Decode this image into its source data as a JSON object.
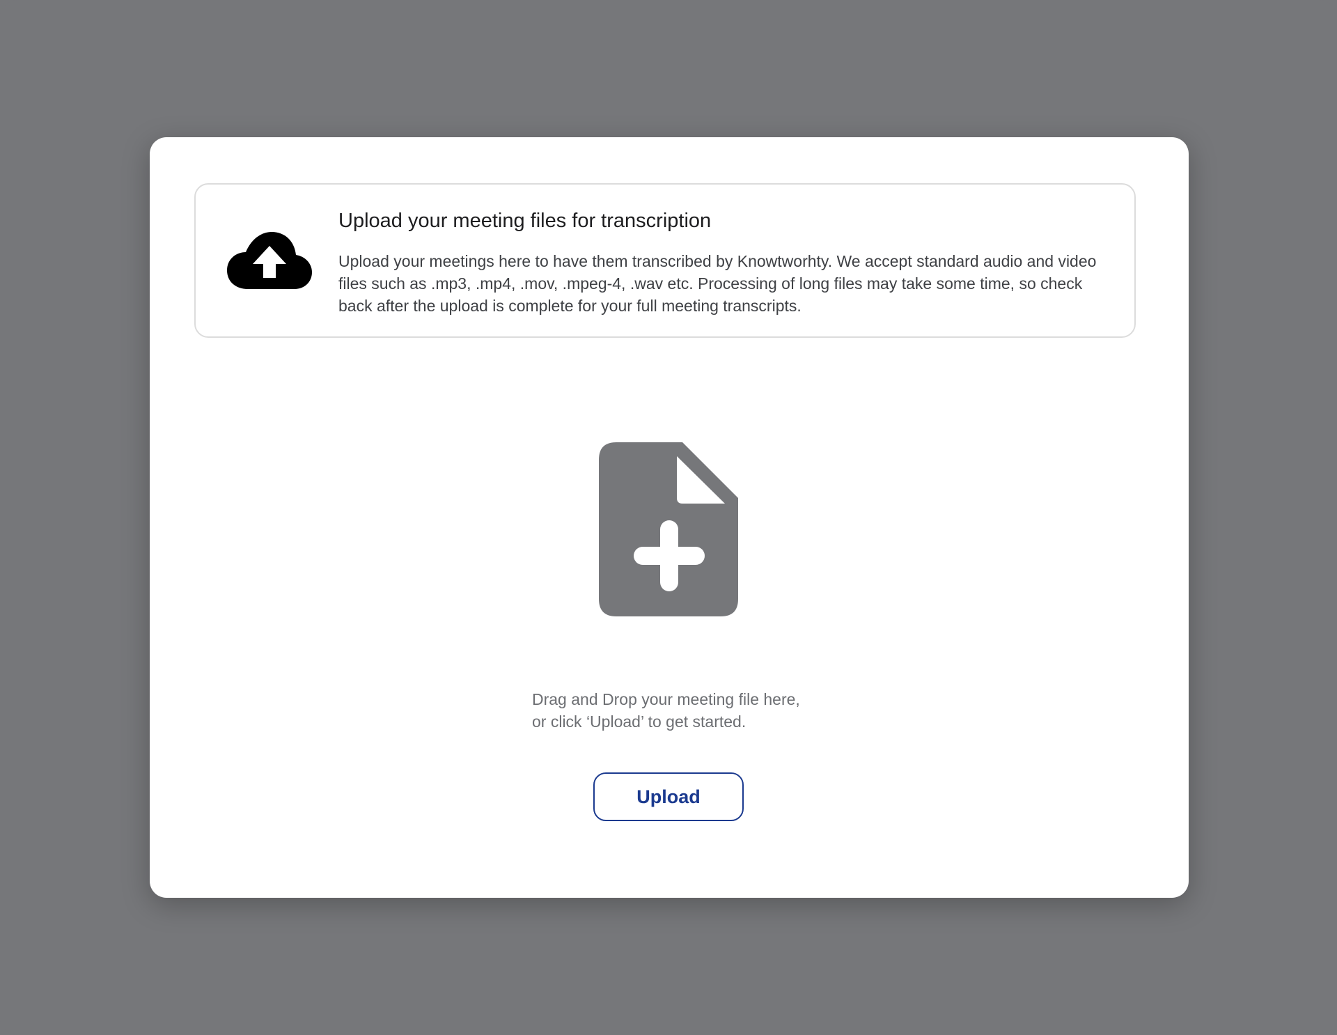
{
  "info": {
    "title": "Upload your meeting files for transcription",
    "description": "Upload your meetings here to have them transcribed by Knowtworhty. We accept standard audio and video files such as .mp3, .mp4, .mov, .mpeg-4, .wav etc. Processing of long files may take some time, so check back after the upload is complete for your full meeting transcripts.",
    "icon": "cloud-upload-icon"
  },
  "dropzone": {
    "icon": "file-add-icon",
    "hint_line1": "Drag and Drop your meeting file here,",
    "hint_line2": "or click ‘Upload’ to get started."
  },
  "upload_button": {
    "label": "Upload"
  },
  "colors": {
    "backdrop": "#76777a",
    "modal": "#ffffff",
    "accent": "#1b3a8f",
    "file_icon": "#76777a",
    "card_border": "#dcdcdc"
  }
}
